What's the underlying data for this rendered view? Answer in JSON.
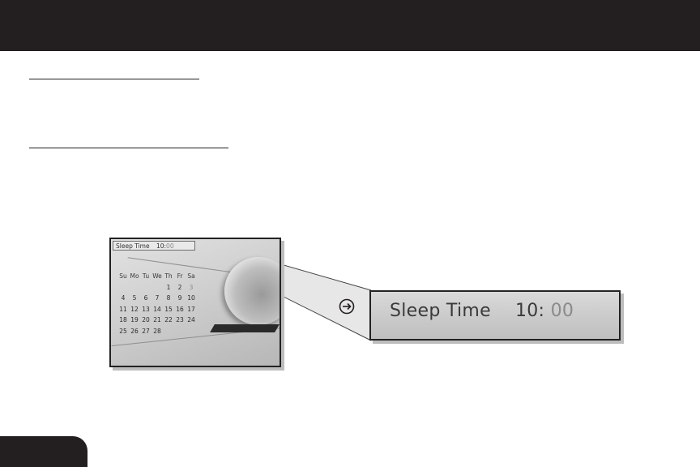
{
  "screen": {
    "status_label": "Sleep Time",
    "status_hours": "10:",
    "status_minutes": "00",
    "calendar": {
      "weekdays": [
        "Su",
        "Mo",
        "Tu",
        "We",
        "Th",
        "Fr",
        "Sa"
      ],
      "weeks": [
        [
          "",
          "",
          "",
          "",
          "1",
          "2",
          "3"
        ],
        [
          "4",
          "5",
          "6",
          "7",
          "8",
          "9",
          "10"
        ],
        [
          "11",
          "12",
          "13",
          "14",
          "15",
          "16",
          "17"
        ],
        [
          "18",
          "19",
          "20",
          "21",
          "22",
          "23",
          "24"
        ],
        [
          "25",
          "26",
          "27",
          "28",
          "",
          "",
          ""
        ]
      ]
    }
  },
  "zoom": {
    "label": "Sleep Time",
    "hours": "10:",
    "minutes": "00"
  },
  "icons": {
    "callout_arrow": "arrow-right-circle-icon"
  }
}
